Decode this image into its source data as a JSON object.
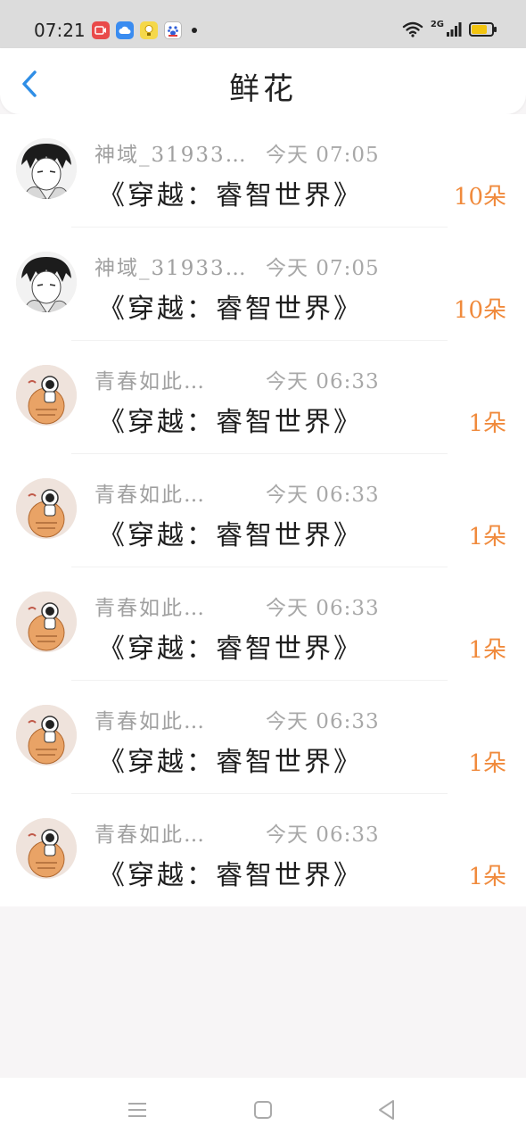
{
  "status_bar": {
    "time": "07:21",
    "notifications": [
      "video-app-icon",
      "cloud-app-icon",
      "bulb-app-icon",
      "baidu-app-icon"
    ],
    "network": "2G",
    "battery_level": 0.75,
    "battery_color": "#f2c40f"
  },
  "header": {
    "title": "鲜花",
    "back_icon": "chevron-left-icon",
    "accent": "#2f8ee6"
  },
  "rows": [
    {
      "user": "神域_31933…",
      "time": "今天 07:05",
      "book": "《穿越：睿智世界》",
      "amount": "10朵",
      "avatar": "anime-boy"
    },
    {
      "user": "神域_31933…",
      "time": "今天 07:05",
      "book": "《穿越：睿智世界》",
      "amount": "10朵",
      "avatar": "anime-boy"
    },
    {
      "user": "青春如此…",
      "time": "今天 06:33",
      "book": "《穿越：睿智世界》",
      "amount": "1朵",
      "avatar": "astronaut"
    },
    {
      "user": "青春如此…",
      "time": "今天 06:33",
      "book": "《穿越：睿智世界》",
      "amount": "1朵",
      "avatar": "astronaut"
    },
    {
      "user": "青春如此…",
      "time": "今天 06:33",
      "book": "《穿越：睿智世界》",
      "amount": "1朵",
      "avatar": "astronaut"
    },
    {
      "user": "青春如此…",
      "time": "今天 06:33",
      "book": "《穿越：睿智世界》",
      "amount": "1朵",
      "avatar": "astronaut"
    },
    {
      "user": "青春如此…",
      "time": "今天 06:33",
      "book": "《穿越：睿智世界》",
      "amount": "1朵",
      "avatar": "astronaut"
    }
  ],
  "colors": {
    "amount": "#f08a3c",
    "secondary_text": "#a0a0a0",
    "primary_text": "#1e1e1e"
  },
  "nav_bar": {
    "items": [
      "menu-icon",
      "home-square-icon",
      "back-triangle-icon"
    ]
  }
}
